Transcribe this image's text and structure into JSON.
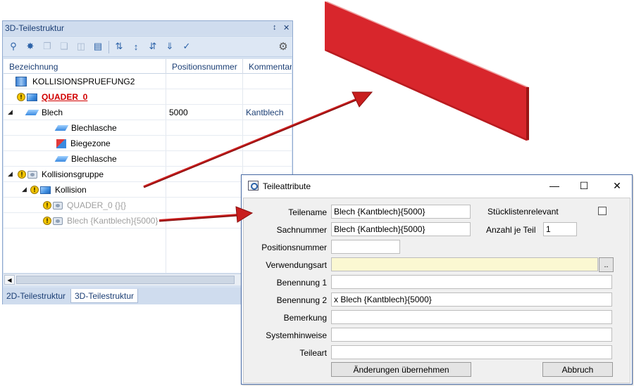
{
  "panel": {
    "title": "3D-Teilestruktur",
    "pin_glyph": "↕",
    "close_glyph": "✕",
    "columns": [
      "Bezeichnung",
      "Positionsnummer",
      "Kommentar"
    ],
    "rows": [
      {
        "label": "KOLLISIONSPRUEFUNG2",
        "pos": "",
        "comment": ""
      },
      {
        "label": "QUADER_0",
        "pos": "",
        "comment": ""
      },
      {
        "label": "Blech",
        "pos": "5000",
        "comment": "Kantblech"
      },
      {
        "label": "Blechlasche",
        "pos": "",
        "comment": ""
      },
      {
        "label": "Biegezone",
        "pos": "",
        "comment": ""
      },
      {
        "label": "Blechlasche",
        "pos": "",
        "comment": ""
      },
      {
        "label": "Kollisionsgruppe",
        "pos": "",
        "comment": ""
      },
      {
        "label": "Kollision",
        "pos": "",
        "comment": ""
      },
      {
        "label": "QUADER_0 {}{}",
        "pos": "",
        "comment": ""
      },
      {
        "label": "Blech {Kantblech}{5000}",
        "pos": "",
        "comment": ""
      }
    ],
    "tabs": [
      "2D-Teilestruktur",
      "3D-Teilestruktur"
    ],
    "expander_glyph": "◢",
    "warn_glyph": "!"
  },
  "dialog": {
    "title": "Teileattribute",
    "window_buttons": {
      "minimize": "—",
      "maximize": "☐",
      "close": "✕"
    },
    "fields": {
      "teilename": {
        "label": "Teilename",
        "value": "Blech {Kantblech}{5000}"
      },
      "sachnummer": {
        "label": "Sachnummer",
        "value": "Blech {Kantblech}{5000}"
      },
      "positionsnummer": {
        "label": "Positionsnummer",
        "value": ""
      },
      "verwendungsart": {
        "label": "Verwendungsart",
        "value": ""
      },
      "benennung1": {
        "label": "Benennung 1",
        "value": ""
      },
      "benennung2": {
        "label": "Benennung 2",
        "value": "x Blech {Kantblech}{5000}"
      },
      "bemerkung": {
        "label": "Bemerkung",
        "value": ""
      },
      "systemhinweise": {
        "label": "Systemhinweise",
        "value": ""
      },
      "teileart": {
        "label": "Teileart",
        "value": ""
      }
    },
    "stuecklistenrelevant": {
      "label": "Stücklistenrelevant",
      "checked": false
    },
    "anzahl_je_teil": {
      "label": "Anzahl je Teil",
      "value": "1"
    },
    "browse_label": "..",
    "apply_button": "Änderungen übernehmen",
    "cancel_button": "Abbruch"
  },
  "colors": {
    "object_red": "#d8262c",
    "arrow_red": "#c81e1e",
    "panel_header_text": "#1c3f75",
    "warning_text": "#d10000"
  }
}
